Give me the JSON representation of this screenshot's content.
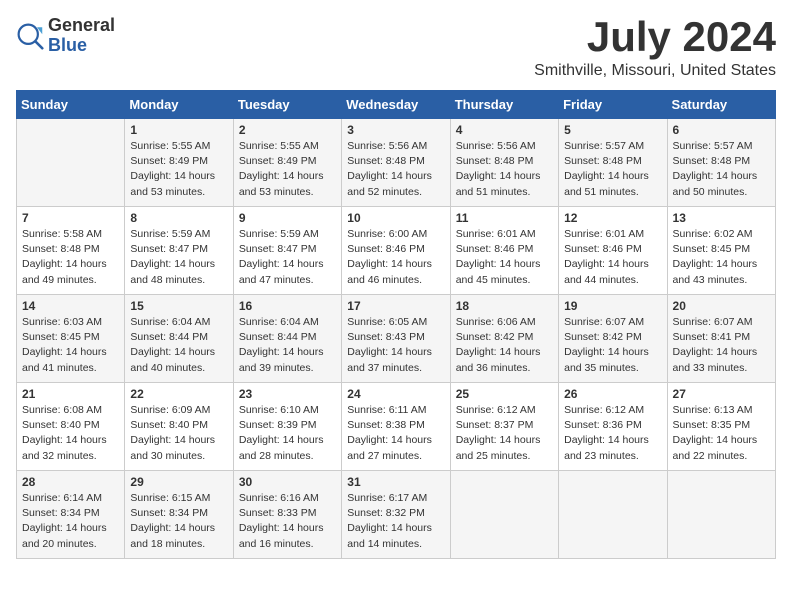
{
  "header": {
    "logo_general": "General",
    "logo_blue": "Blue",
    "month_title": "July 2024",
    "location": "Smithville, Missouri, United States"
  },
  "days_of_week": [
    "Sunday",
    "Monday",
    "Tuesday",
    "Wednesday",
    "Thursday",
    "Friday",
    "Saturday"
  ],
  "weeks": [
    [
      {
        "day": "",
        "content": ""
      },
      {
        "day": "1",
        "content": "Sunrise: 5:55 AM\nSunset: 8:49 PM\nDaylight: 14 hours\nand 53 minutes."
      },
      {
        "day": "2",
        "content": "Sunrise: 5:55 AM\nSunset: 8:49 PM\nDaylight: 14 hours\nand 53 minutes."
      },
      {
        "day": "3",
        "content": "Sunrise: 5:56 AM\nSunset: 8:48 PM\nDaylight: 14 hours\nand 52 minutes."
      },
      {
        "day": "4",
        "content": "Sunrise: 5:56 AM\nSunset: 8:48 PM\nDaylight: 14 hours\nand 51 minutes."
      },
      {
        "day": "5",
        "content": "Sunrise: 5:57 AM\nSunset: 8:48 PM\nDaylight: 14 hours\nand 51 minutes."
      },
      {
        "day": "6",
        "content": "Sunrise: 5:57 AM\nSunset: 8:48 PM\nDaylight: 14 hours\nand 50 minutes."
      }
    ],
    [
      {
        "day": "7",
        "content": "Sunrise: 5:58 AM\nSunset: 8:48 PM\nDaylight: 14 hours\nand 49 minutes."
      },
      {
        "day": "8",
        "content": "Sunrise: 5:59 AM\nSunset: 8:47 PM\nDaylight: 14 hours\nand 48 minutes."
      },
      {
        "day": "9",
        "content": "Sunrise: 5:59 AM\nSunset: 8:47 PM\nDaylight: 14 hours\nand 47 minutes."
      },
      {
        "day": "10",
        "content": "Sunrise: 6:00 AM\nSunset: 8:46 PM\nDaylight: 14 hours\nand 46 minutes."
      },
      {
        "day": "11",
        "content": "Sunrise: 6:01 AM\nSunset: 8:46 PM\nDaylight: 14 hours\nand 45 minutes."
      },
      {
        "day": "12",
        "content": "Sunrise: 6:01 AM\nSunset: 8:46 PM\nDaylight: 14 hours\nand 44 minutes."
      },
      {
        "day": "13",
        "content": "Sunrise: 6:02 AM\nSunset: 8:45 PM\nDaylight: 14 hours\nand 43 minutes."
      }
    ],
    [
      {
        "day": "14",
        "content": "Sunrise: 6:03 AM\nSunset: 8:45 PM\nDaylight: 14 hours\nand 41 minutes."
      },
      {
        "day": "15",
        "content": "Sunrise: 6:04 AM\nSunset: 8:44 PM\nDaylight: 14 hours\nand 40 minutes."
      },
      {
        "day": "16",
        "content": "Sunrise: 6:04 AM\nSunset: 8:44 PM\nDaylight: 14 hours\nand 39 minutes."
      },
      {
        "day": "17",
        "content": "Sunrise: 6:05 AM\nSunset: 8:43 PM\nDaylight: 14 hours\nand 37 minutes."
      },
      {
        "day": "18",
        "content": "Sunrise: 6:06 AM\nSunset: 8:42 PM\nDaylight: 14 hours\nand 36 minutes."
      },
      {
        "day": "19",
        "content": "Sunrise: 6:07 AM\nSunset: 8:42 PM\nDaylight: 14 hours\nand 35 minutes."
      },
      {
        "day": "20",
        "content": "Sunrise: 6:07 AM\nSunset: 8:41 PM\nDaylight: 14 hours\nand 33 minutes."
      }
    ],
    [
      {
        "day": "21",
        "content": "Sunrise: 6:08 AM\nSunset: 8:40 PM\nDaylight: 14 hours\nand 32 minutes."
      },
      {
        "day": "22",
        "content": "Sunrise: 6:09 AM\nSunset: 8:40 PM\nDaylight: 14 hours\nand 30 minutes."
      },
      {
        "day": "23",
        "content": "Sunrise: 6:10 AM\nSunset: 8:39 PM\nDaylight: 14 hours\nand 28 minutes."
      },
      {
        "day": "24",
        "content": "Sunrise: 6:11 AM\nSunset: 8:38 PM\nDaylight: 14 hours\nand 27 minutes."
      },
      {
        "day": "25",
        "content": "Sunrise: 6:12 AM\nSunset: 8:37 PM\nDaylight: 14 hours\nand 25 minutes."
      },
      {
        "day": "26",
        "content": "Sunrise: 6:12 AM\nSunset: 8:36 PM\nDaylight: 14 hours\nand 23 minutes."
      },
      {
        "day": "27",
        "content": "Sunrise: 6:13 AM\nSunset: 8:35 PM\nDaylight: 14 hours\nand 22 minutes."
      }
    ],
    [
      {
        "day": "28",
        "content": "Sunrise: 6:14 AM\nSunset: 8:34 PM\nDaylight: 14 hours\nand 20 minutes."
      },
      {
        "day": "29",
        "content": "Sunrise: 6:15 AM\nSunset: 8:34 PM\nDaylight: 14 hours\nand 18 minutes."
      },
      {
        "day": "30",
        "content": "Sunrise: 6:16 AM\nSunset: 8:33 PM\nDaylight: 14 hours\nand 16 minutes."
      },
      {
        "day": "31",
        "content": "Sunrise: 6:17 AM\nSunset: 8:32 PM\nDaylight: 14 hours\nand 14 minutes."
      },
      {
        "day": "",
        "content": ""
      },
      {
        "day": "",
        "content": ""
      },
      {
        "day": "",
        "content": ""
      }
    ]
  ]
}
